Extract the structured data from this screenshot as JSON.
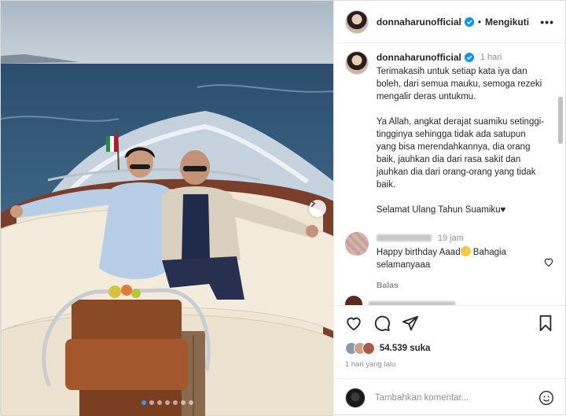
{
  "post": {
    "username": "donnaharunofficial",
    "follow_label": "Mengikuti",
    "separator": "•",
    "caption_time": "1 hari",
    "caption": [
      "Terimakasih untuk setiap kata iya dan boleh, dari semua mauku, semoga rezeki mengalir deras untukmu.",
      "Ya Allah, angkat derajat suamiku setinggi-tingginya sehingga tidak ada satupun yang bisa merendahkannya, dia orang baik, jauhkan dia dari rasa sakit dan jauhkan dia dari orang-orang yang tidak baik.",
      "Selamat Ulang Tahun Suamiku♥"
    ],
    "likes": "54.539 suka",
    "date": "1 hari yang lalu"
  },
  "comment": {
    "time": "19 jam",
    "text_before": "Happy birthday Aaad",
    "text_after": " Bahagia selamanyaaa",
    "reply_label": "Balas"
  },
  "composer": {
    "placeholder": "Tambahkan komentar..."
  },
  "icons": {
    "verified": "verified-badge-icon",
    "more": "more-options-icon",
    "like": "heart-icon",
    "comment": "comment-icon",
    "share": "paper-plane-icon",
    "save": "bookmark-icon",
    "emoji": "emoji-icon",
    "next": "chevron-right-icon"
  },
  "carousel": {
    "slide_count": 7,
    "active_index": 0
  },
  "colors": {
    "accent": "#3797f0",
    "verified": "#0095f6"
  }
}
